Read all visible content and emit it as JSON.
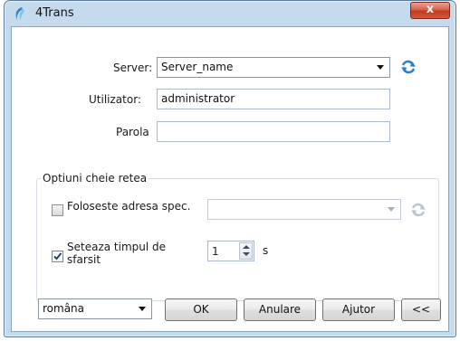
{
  "window": {
    "title": "4Trans",
    "close_glyph": "x"
  },
  "form": {
    "server_label": "Server:",
    "server_value": "Server_name",
    "user_label": "Utilizator:",
    "user_value": "administrator",
    "password_label": "Parola",
    "password_value": ""
  },
  "network": {
    "group_title": "Optiuni cheie retea",
    "use_address_label": "Foloseste adresa spec.",
    "use_address_checked": false,
    "address_value": "",
    "set_time_label": "Seteaza timpul de sfarsit",
    "set_time_checked": true,
    "time_value": "1",
    "time_unit": "s"
  },
  "footer": {
    "language_value": "româna",
    "ok_label": "OK",
    "cancel_label": "Anulare",
    "help_label": "Ajutor",
    "collapse_label": "<<"
  },
  "icons": {
    "app": "app-icon",
    "refresh": "refresh-icon",
    "checkmark": "checkmark-icon"
  },
  "colors": {
    "title_bar": "#c6daee",
    "close_button": "#c8442c",
    "refresh_active": "#2a7fc7",
    "refresh_disabled": "#b9c6d2"
  }
}
